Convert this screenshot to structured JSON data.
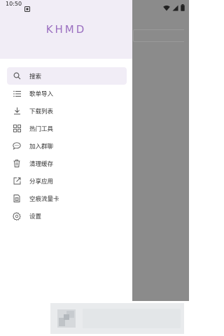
{
  "status_bar": {
    "time": "10:50",
    "icons": [
      "notification-icon",
      "wifi-icon",
      "signal-icon",
      "battery-icon"
    ]
  },
  "drawer": {
    "brand": "KHMD",
    "accent_color": "#9b6fc0",
    "header_bg": "#f1edf6",
    "items": [
      {
        "label": "搜索",
        "icon": "search-icon",
        "active": true
      },
      {
        "label": "歌单导入",
        "icon": "list-icon"
      },
      {
        "label": "下载列表",
        "icon": "download-icon"
      },
      {
        "label": "热门工具",
        "icon": "grid-icon"
      },
      {
        "label": "加入群聊",
        "icon": "chat-icon"
      },
      {
        "label": "清理缓存",
        "icon": "trash-icon"
      },
      {
        "label": "分享应用",
        "icon": "share-icon"
      },
      {
        "label": "空痕流量卡",
        "icon": "sim-card-icon"
      },
      {
        "label": "设置",
        "icon": "settings-icon"
      }
    ]
  }
}
